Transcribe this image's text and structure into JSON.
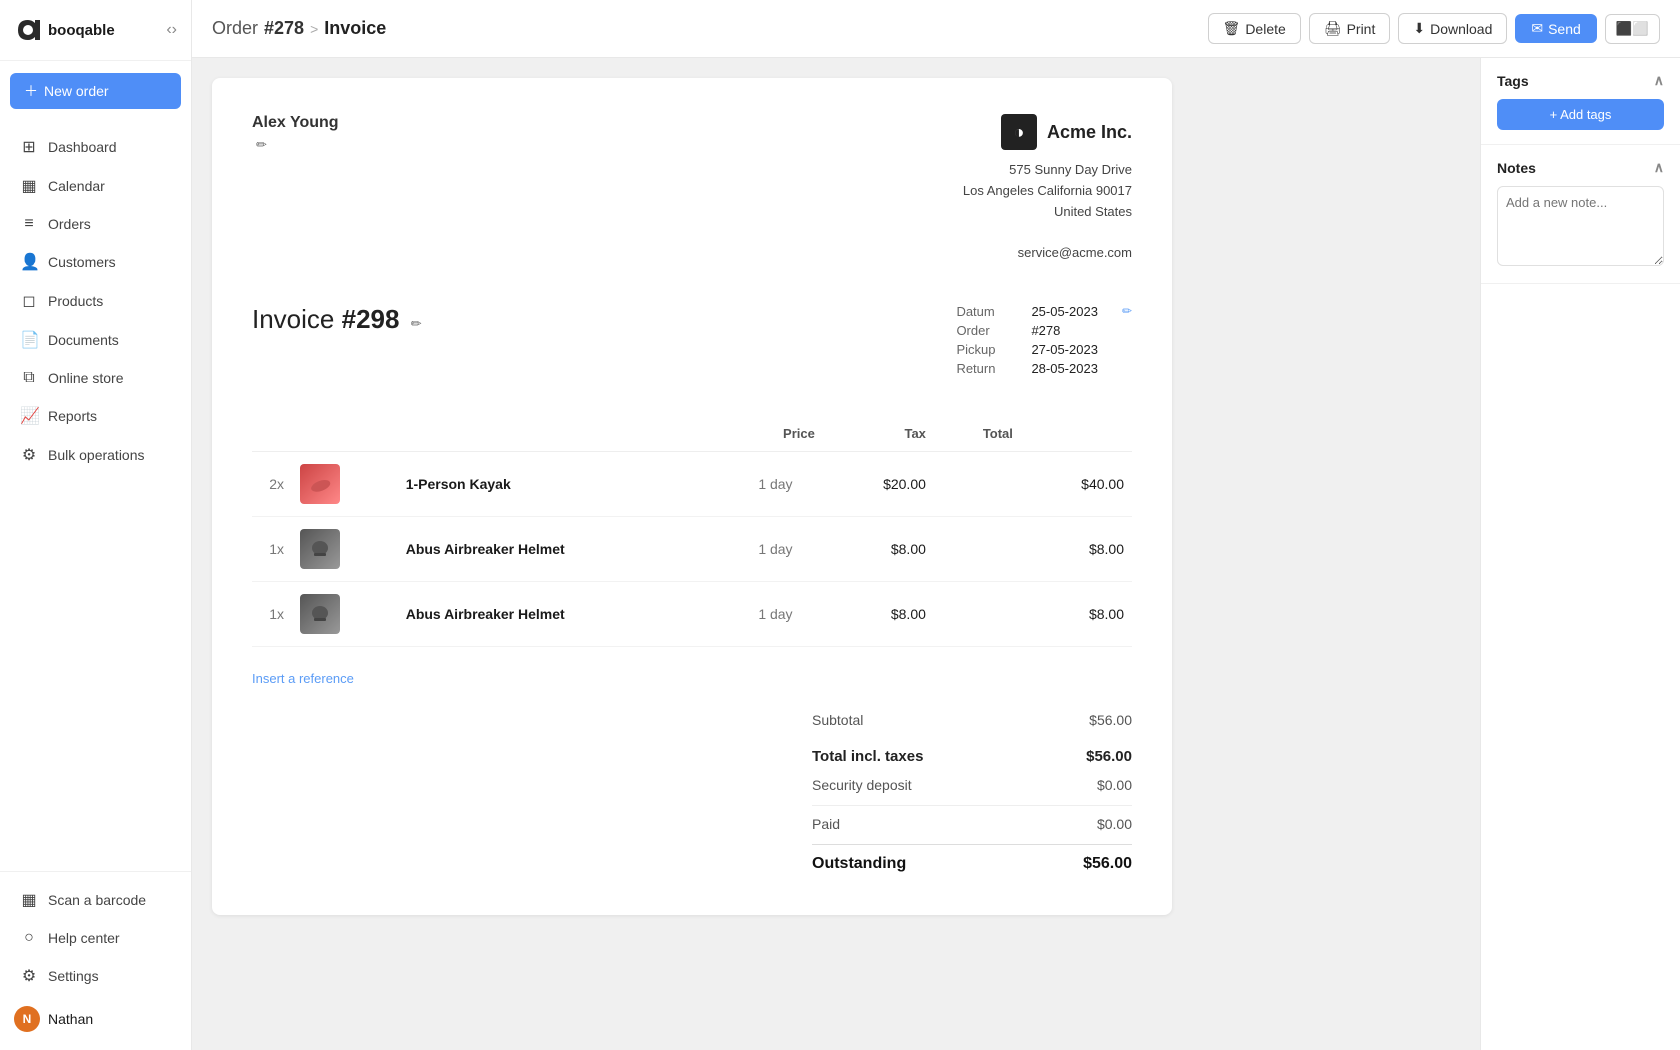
{
  "app": {
    "name": "booqable",
    "logo_text": "booqable"
  },
  "sidebar": {
    "new_order_label": "New order",
    "collapse_tooltip": "Collapse",
    "nav_items": [
      {
        "id": "dashboard",
        "label": "Dashboard",
        "icon": "⊞"
      },
      {
        "id": "calendar",
        "label": "Calendar",
        "icon": "📅"
      },
      {
        "id": "orders",
        "label": "Orders",
        "icon": "📋"
      },
      {
        "id": "customers",
        "label": "Customers",
        "icon": "👥"
      },
      {
        "id": "products",
        "label": "Products",
        "icon": "📦"
      },
      {
        "id": "documents",
        "label": "Documents",
        "icon": "📄"
      },
      {
        "id": "online-store",
        "label": "Online store",
        "icon": "🛒"
      },
      {
        "id": "reports",
        "label": "Reports",
        "icon": "📊"
      },
      {
        "id": "bulk-operations",
        "label": "Bulk operations",
        "icon": "⚙"
      }
    ],
    "bottom_items": [
      {
        "id": "scan-barcode",
        "label": "Scan a barcode",
        "icon": "▦"
      },
      {
        "id": "help-center",
        "label": "Help center",
        "icon": "○"
      },
      {
        "id": "settings",
        "label": "Settings",
        "icon": "⚙"
      }
    ],
    "user": {
      "name": "Nathan",
      "initials": "N",
      "avatar_color": "#e07020"
    }
  },
  "topbar": {
    "breadcrumb_order": "Order",
    "breadcrumb_order_num": "#278",
    "breadcrumb_separator": ">",
    "breadcrumb_page": "Invoice",
    "delete_label": "Delete",
    "print_label": "Print",
    "download_label": "Download",
    "send_label": "Send"
  },
  "invoice": {
    "client_name": "Alex Young",
    "company_name": "Acme Inc.",
    "company_address_line1": "575 Sunny Day Drive",
    "company_address_line2": "Los Angeles California 90017",
    "company_address_line3": "United States",
    "company_email": "service@acme.com",
    "company_logo_letter": "◑",
    "company_logo_name": "Acme Inc.",
    "invoice_title": "Invoice",
    "invoice_number": "#298",
    "datum_label": "Datum",
    "datum_value": "25-05-2023",
    "order_label": "Order",
    "order_value": "#278",
    "pickup_label": "Pickup",
    "pickup_value": "27-05-2023",
    "return_label": "Return",
    "return_value": "28-05-2023",
    "columns": {
      "price": "Price",
      "tax": "Tax",
      "total": "Total"
    },
    "items": [
      {
        "qty": "2x",
        "name": "1-Person Kayak",
        "duration": "1 day",
        "price": "$20.00",
        "tax": "",
        "total": "$40.00",
        "thumb_type": "kayak"
      },
      {
        "qty": "1x",
        "name": "Abus Airbreaker Helmet",
        "duration": "1 day",
        "price": "$8.00",
        "tax": "",
        "total": "$8.00",
        "thumb_type": "helmet"
      },
      {
        "qty": "1x",
        "name": "Abus Airbreaker Helmet",
        "duration": "1 day",
        "price": "$8.00",
        "tax": "",
        "total": "$8.00",
        "thumb_type": "helmet"
      }
    ],
    "insert_reference_label": "Insert a reference",
    "subtotal_label": "Subtotal",
    "subtotal_value": "$56.00",
    "total_incl_taxes_label": "Total incl. taxes",
    "total_incl_taxes_value": "$56.00",
    "security_deposit_label": "Security deposit",
    "security_deposit_value": "$0.00",
    "paid_label": "Paid",
    "paid_value": "$0.00",
    "outstanding_label": "Outstanding",
    "outstanding_value": "$56.00"
  },
  "right_panel": {
    "tags_section_label": "Tags",
    "add_tags_label": "+ Add tags",
    "notes_section_label": "Notes",
    "notes_placeholder": "Add a new note..."
  }
}
